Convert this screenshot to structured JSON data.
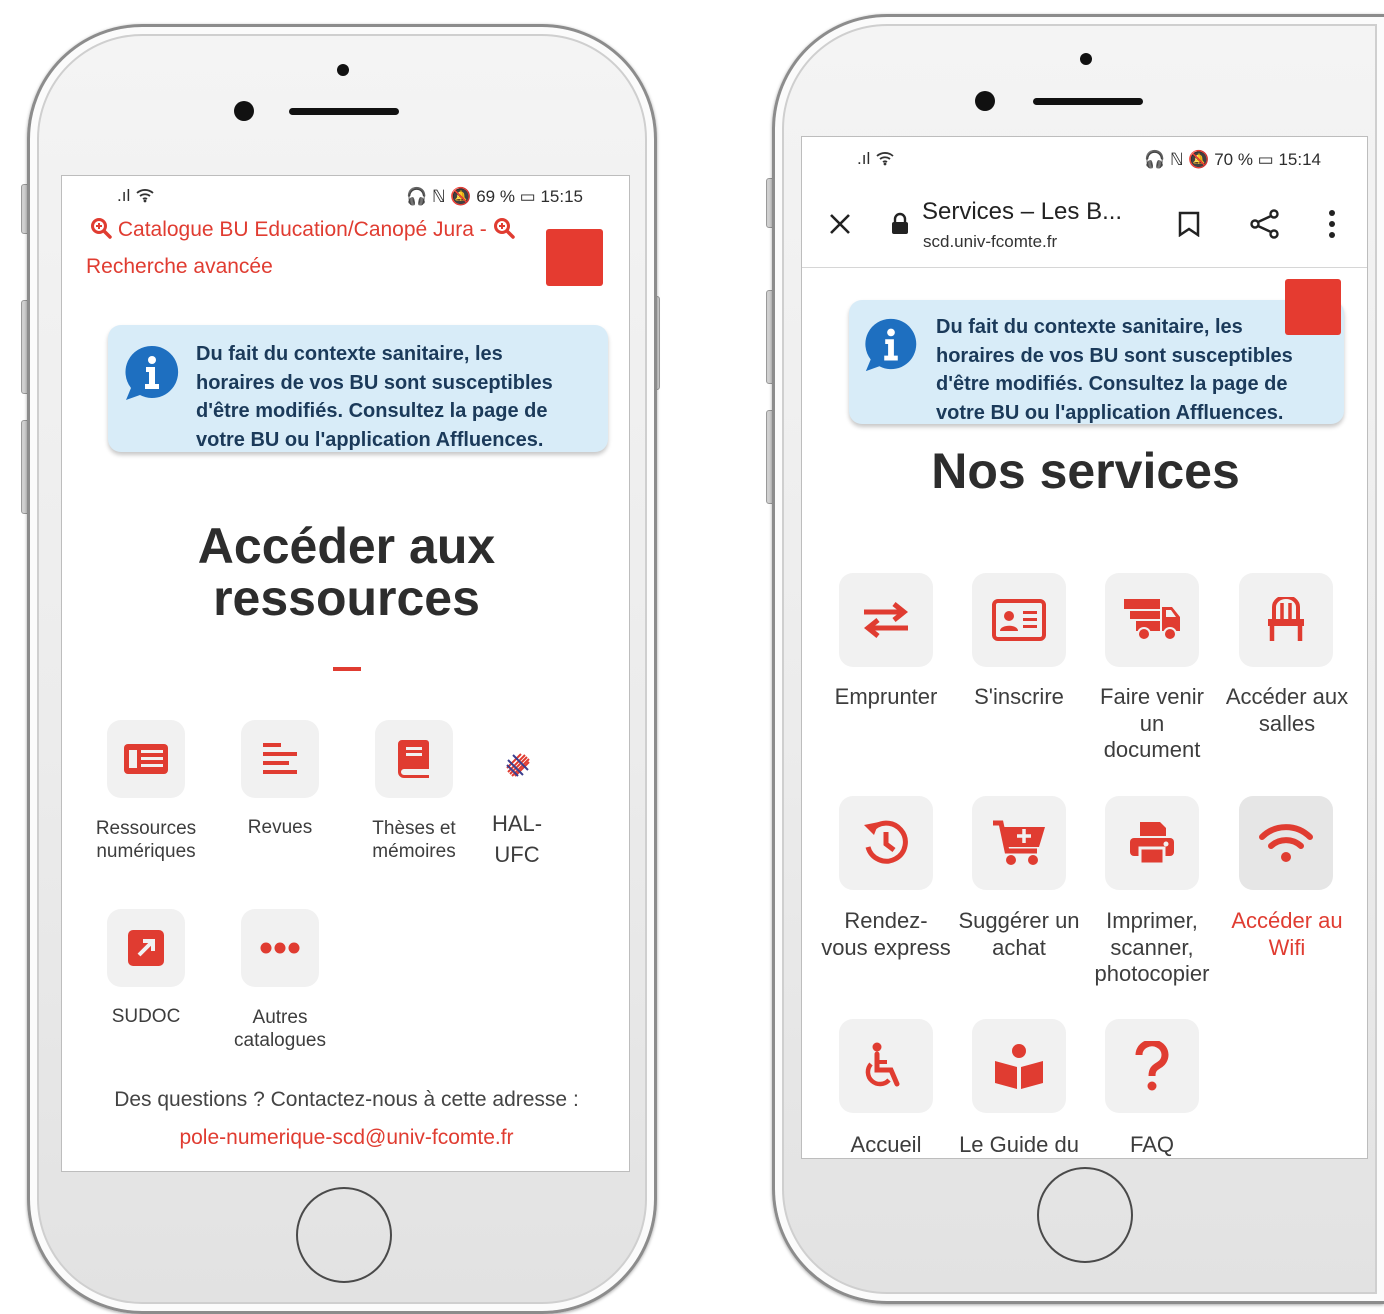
{
  "accent_color": "#e03c31",
  "left": {
    "statusbar": {
      "signal": ".ıl",
      "right": "🎧 ℕ 🔕 69 % ▭ 15:15"
    },
    "search_line1": "Catalogue BU Education/Canopé Jura -",
    "search_line2": "Recherche avancée",
    "notice": [
      "Du fait du contexte sanitaire, les",
      "horaires de vos BU sont susceptibles",
      "d'être modifiés. Consultez la page de",
      "votre BU ou l'application Affluences."
    ],
    "heading": [
      "Accéder aux",
      "ressources"
    ],
    "resources": [
      {
        "icon": "newspaper-icon",
        "label": [
          "Ressources",
          "numériques"
        ]
      },
      {
        "icon": "text-lines-icon",
        "label": [
          "Revues"
        ]
      },
      {
        "icon": "book-icon",
        "label": [
          "Thèses et",
          "mémoires"
        ]
      },
      {
        "icon": "hal-logo-icon",
        "label": [
          "HAL-",
          "UFC"
        ]
      },
      {
        "icon": "external-link-icon",
        "label": [
          "SUDOC"
        ]
      },
      {
        "icon": "more-dots-icon",
        "label": [
          "Autres",
          "catalogues"
        ]
      }
    ],
    "contact_text": "Des questions ? Contactez-nous à cette adresse :",
    "contact_email": "pole-numerique-scd@univ-fcomte.fr"
  },
  "right": {
    "statusbar": {
      "signal": ".ıl",
      "right": "🎧 ℕ 🔕 70 % ▭ 15:14"
    },
    "page_title": "Services – Les B...",
    "url": "scd.univ-fcomte.fr",
    "notice": [
      "Du fait du contexte sanitaire, les",
      "horaires de vos BU sont susceptibles",
      "d'être modifiés. Consultez la page de",
      "votre BU ou l'application Affluences."
    ],
    "heading": "Nos services",
    "services": [
      {
        "icon": "swap-arrows-icon",
        "label": [
          "Emprunter"
        ]
      },
      {
        "icon": "id-card-icon",
        "label": [
          "S'inscrire"
        ]
      },
      {
        "icon": "delivery-truck-icon",
        "label": [
          "Faire venir",
          "un",
          "document"
        ]
      },
      {
        "icon": "chair-icon",
        "label": [
          "Accéder aux",
          "salles"
        ]
      },
      {
        "icon": "history-icon",
        "label": [
          "Rendez-",
          "vous express"
        ]
      },
      {
        "icon": "cart-plus-icon",
        "label": [
          "Suggérer un",
          "achat"
        ]
      },
      {
        "icon": "printer-icon",
        "label": [
          "Imprimer,",
          "scanner,",
          "photocopier"
        ]
      },
      {
        "icon": "wifi-icon",
        "label": [
          "Accéder au",
          "Wifi"
        ]
      },
      {
        "icon": "wheelchair-icon",
        "label": [
          "Accueil"
        ]
      },
      {
        "icon": "reader-book-icon",
        "label": [
          "Le Guide du"
        ]
      },
      {
        "icon": "question-icon",
        "label": [
          "FAQ"
        ]
      }
    ]
  }
}
